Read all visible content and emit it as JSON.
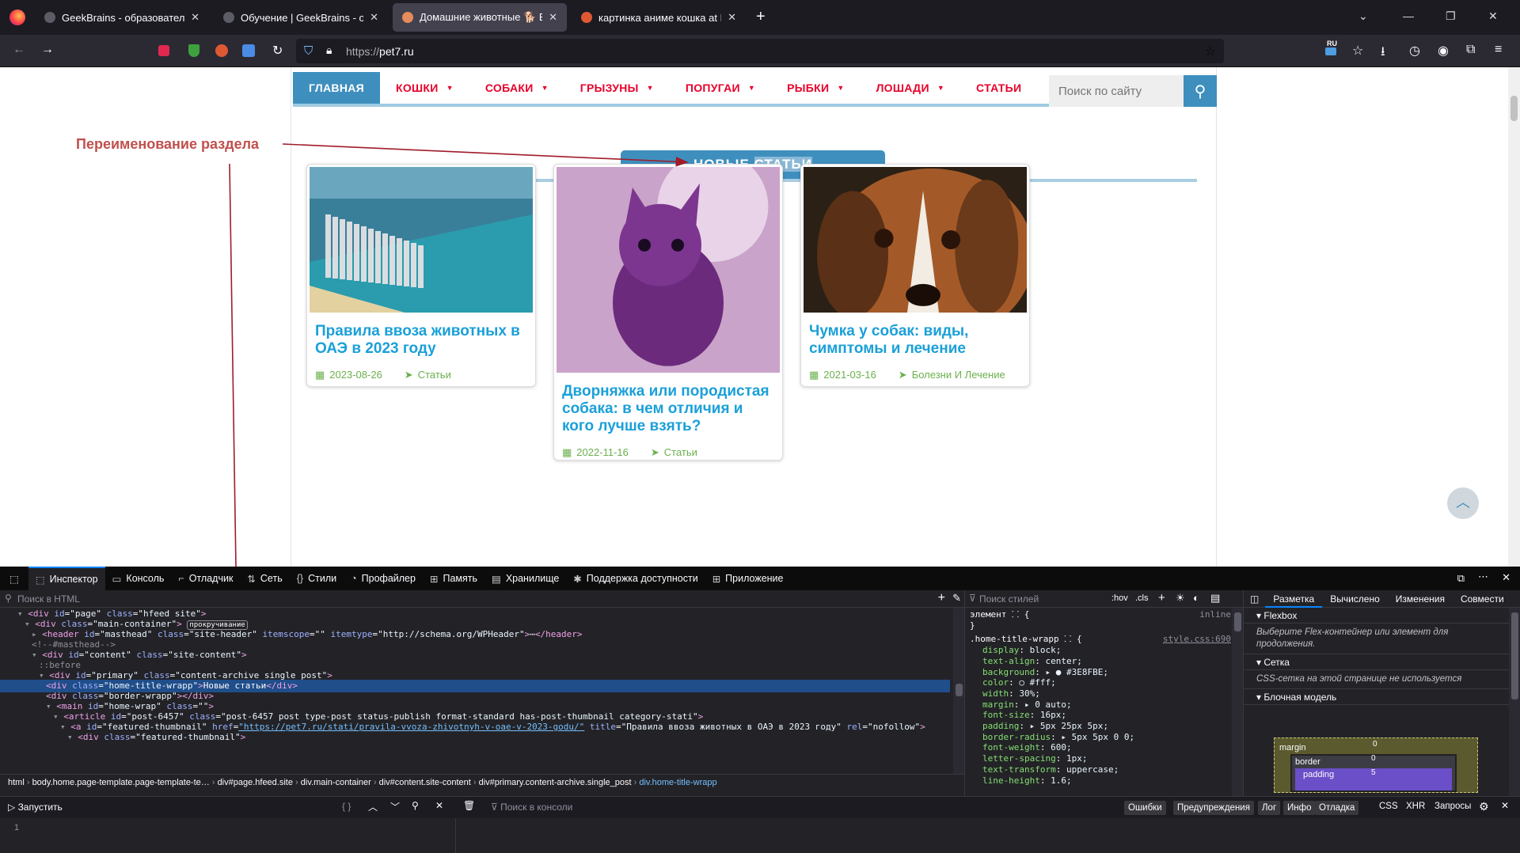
{
  "browser": {
    "tabs": [
      {
        "title": "GeekBrains - образовательный портал",
        "active": false,
        "favicon_color": "#5c5c66"
      },
      {
        "title": "Обучение | GeekBrains - образовательный портал",
        "active": false,
        "favicon_color": "#5c5c66"
      },
      {
        "title": "Домашние животные 🐕 Все",
        "active": true,
        "favicon_color": "#e58b5c"
      },
      {
        "title": "картинка аниме кошка at DuckDuckGo",
        "active": false,
        "favicon_color": "#de5833"
      }
    ],
    "url_host": "pet7.ru",
    "url_scheme": "https://",
    "lang_badge": "RU"
  },
  "site": {
    "menu": [
      {
        "label": "Главная",
        "dropdown": false,
        "active": true
      },
      {
        "label": "Кошки",
        "dropdown": true
      },
      {
        "label": "Собаки",
        "dropdown": true
      },
      {
        "label": "Грызуны",
        "dropdown": true
      },
      {
        "label": "Попугаи",
        "dropdown": true
      },
      {
        "label": "Рыбки",
        "dropdown": true
      },
      {
        "label": "Лошади",
        "dropdown": true
      },
      {
        "label": "Статьи",
        "dropdown": false
      }
    ],
    "search_placeholder": "Поиск по сайту",
    "section_title_word1": "НОВЫЕ",
    "section_title_word2": "СТАТЬИ",
    "annotation": "Переименование раздела",
    "cards": [
      {
        "title": "Правила ввоза животных в ОАЭ в 2023 году",
        "date": "2023-08-26",
        "category": "Статьи",
        "image": "dubai-coast-photo"
      },
      {
        "title": "Дворняжка или породистая собака: в чем отличия и кого лучше взять?",
        "date": "2022-11-16",
        "category": "Статьи",
        "image": "anime-purple-kitten"
      },
      {
        "title": "Чумка у собак: виды, симптомы и лечение",
        "date": "2021-03-16",
        "category": "Болезни И Лечение",
        "image": "beagle-face-photo"
      }
    ],
    "colors": {
      "accent": "#3e8fbe",
      "menu_text": "#e8002a",
      "title": "#1aa0d8",
      "meta": "#6ab04c"
    }
  },
  "devtools": {
    "tabs": [
      "Инспектор",
      "Консоль",
      "Отладчик",
      "Сеть",
      "Стили",
      "Профайлер",
      "Память",
      "Хранилище",
      "Поддержка доступности",
      "Приложение"
    ],
    "html_search_placeholder": "Поиск в HTML",
    "tree": [
      {
        "indent": 0,
        "exp": "▾",
        "html": "<span class='tg'>&lt;div</span> <span class='at'>id</span>=<span class='av'>\"page\"</span> <span class='at'>class</span>=<span class='av'>\"hfeed site\"</span><span class='tg'>&gt;</span>"
      },
      {
        "indent": 1,
        "exp": "▾",
        "html": "<span class='tg'>&lt;div</span> <span class='at'>class</span>=<span class='av'>\"main-container\"</span><span class='tg'>&gt;</span> <span style='border:1px solid #8f8f9d;border-radius:3px;padding:0 2px;font-size:9px'>прокручивание</span>"
      },
      {
        "indent": 2,
        "exp": "▸",
        "html": "<span class='tg'>&lt;header</span> <span class='at'>id</span>=<span class='av'>\"masthead\"</span> <span class='at'>class</span>=<span class='av'>\"site-header\"</span> <span class='at'>itemscope</span>=<span class='av'>\"\"</span> <span class='at'>itemtype</span>=<span class='av'>\"http://schema.org/WPHeader\"</span><span class='tg'>&gt;</span>⋯<span class='tg'>&lt;/header&gt;</span>"
      },
      {
        "indent": 2,
        "exp": "",
        "html": "<span class='cm'>&lt;!--#masthead--&gt;</span>"
      },
      {
        "indent": 2,
        "exp": "▾",
        "html": "<span class='tg'>&lt;div</span> <span class='at'>id</span>=<span class='av'>\"content\"</span> <span class='at'>class</span>=<span class='av'>\"site-content\"</span><span class='tg'>&gt;</span>"
      },
      {
        "indent": 3,
        "exp": "",
        "html": "<span class='cm'>::before</span>"
      },
      {
        "indent": 3,
        "exp": "▾",
        "html": "<span class='tg'>&lt;div</span> <span class='at'>id</span>=<span class='av'>\"primary\"</span> <span class='at'>class</span>=<span class='av'>\"content-archive single_post\"</span><span class='tg'>&gt;</span>"
      },
      {
        "indent": 4,
        "exp": "",
        "sel": true,
        "html": "<span class='tg'>&lt;div</span> <span class='at'>class</span>=<span class='av'>\"home-title-wrapp\"</span><span class='tg'>&gt;</span>Новые статьи<span class='tg'>&lt;/div&gt;</span>"
      },
      {
        "indent": 4,
        "exp": "",
        "html": "<span class='tg'>&lt;div</span> <span class='at'>class</span>=<span class='av'>\"border-wrapp\"</span><span class='tg'>&gt;&lt;/div&gt;</span>"
      },
      {
        "indent": 4,
        "exp": "▾",
        "html": "<span class='tg'>&lt;main</span> <span class='at'>id</span>=<span class='av'>\"home-wrap\"</span> <span class='at'>class</span>=<span class='av'>\"\"</span><span class='tg'>&gt;</span>"
      },
      {
        "indent": 5,
        "exp": "▾",
        "html": "<span class='tg'>&lt;article</span> <span class='at'>id</span>=<span class='av'>\"post-6457\"</span> <span class='at'>class</span>=<span class='av'>\"post-6457 post type-post status-publish format-standard has-post-thumbnail category-stati\"</span><span class='tg'>&gt;</span>"
      },
      {
        "indent": 6,
        "exp": "▾",
        "html": "<span class='tg'>&lt;a</span> <span class='at'>id</span>=<span class='av'>\"featured-thumbnail\"</span> <span class='at'>href</span>=<span class='lk'>\"https://pet7.ru/stati/pravila-vvoza-zhivotnyh-v-oae-v-2023-godu/\"</span> <span class='at'>title</span>=<span class='av'>\"Правила ввоза животных в ОАЭ в 2023 году\"</span> <span class='at'>rel</span>=<span class='av'>\"nofollow\"</span><span class='tg'>&gt;</span>"
      },
      {
        "indent": 7,
        "exp": "▾",
        "html": "<span class='tg'>&lt;div</span> <span class='at'>class</span>=<span class='av'>\"featured-thumbnail\"</span><span class='tg'>&gt;</span>"
      }
    ],
    "breadcrumbs": [
      "html",
      "body.home.page-template.page-template-te…",
      "div#page.hfeed.site",
      "div.main-container",
      "div#content.site-content",
      "div#primary.content-archive.single_post",
      "div.home-title-wrapp"
    ],
    "styles_search_placeholder": "Поиск стилей",
    "styles_toggles": [
      ":hov",
      ".cls"
    ],
    "element_rule": "элемент ⸬ {",
    "element_rule_close": "}",
    "inline_label": "inline",
    "rule_selector": ".home-title-wrapp ⸬ {",
    "rule_source": "style.css:690",
    "rule_props": [
      {
        "n": "display",
        "v": "block;"
      },
      {
        "n": "text-align",
        "v": "center;"
      },
      {
        "n": "background",
        "v": "▸ ● #3E8FBE;"
      },
      {
        "n": "color",
        "v": "○ #fff;"
      },
      {
        "n": "width",
        "v": "30%;"
      },
      {
        "n": "margin",
        "v": "▸ 0 auto;"
      },
      {
        "n": "font-size",
        "v": "16px;"
      },
      {
        "n": "padding",
        "v": "▸ 5px 25px 5px;"
      },
      {
        "n": "border-radius",
        "v": "▸ 5px 5px 0 0;"
      },
      {
        "n": "font-weight",
        "v": "600;"
      },
      {
        "n": "letter-spacing",
        "v": "1px;"
      },
      {
        "n": "text-transform",
        "v": "uppercase;"
      },
      {
        "n": "line-height",
        "v": "1.6;"
      }
    ],
    "layout_tabs": [
      "Разметка",
      "Вычислено",
      "Изменения",
      "Совмести"
    ],
    "flexbox_label": "Flexbox",
    "flexbox_note": "Выберите Flex-контейнер или элемент для продолжения.",
    "grid_label": "Сетка",
    "grid_note": "CSS-сетка на этой странице не используется",
    "boxmodel_label": "Блочная модель",
    "box": {
      "margin": "margin",
      "margin_val": "0",
      "border": "border",
      "border_val": "0",
      "padding": "padding",
      "padding_val": "5"
    },
    "console_run": "Запустить",
    "console_filter": "Поиск в консоли",
    "console_line": "1",
    "console_levels": [
      "Ошибки",
      "Предупреждения",
      "Лог",
      "Инфо",
      "Отладка"
    ],
    "console_types": [
      "CSS",
      "XHR",
      "Запросы"
    ]
  }
}
